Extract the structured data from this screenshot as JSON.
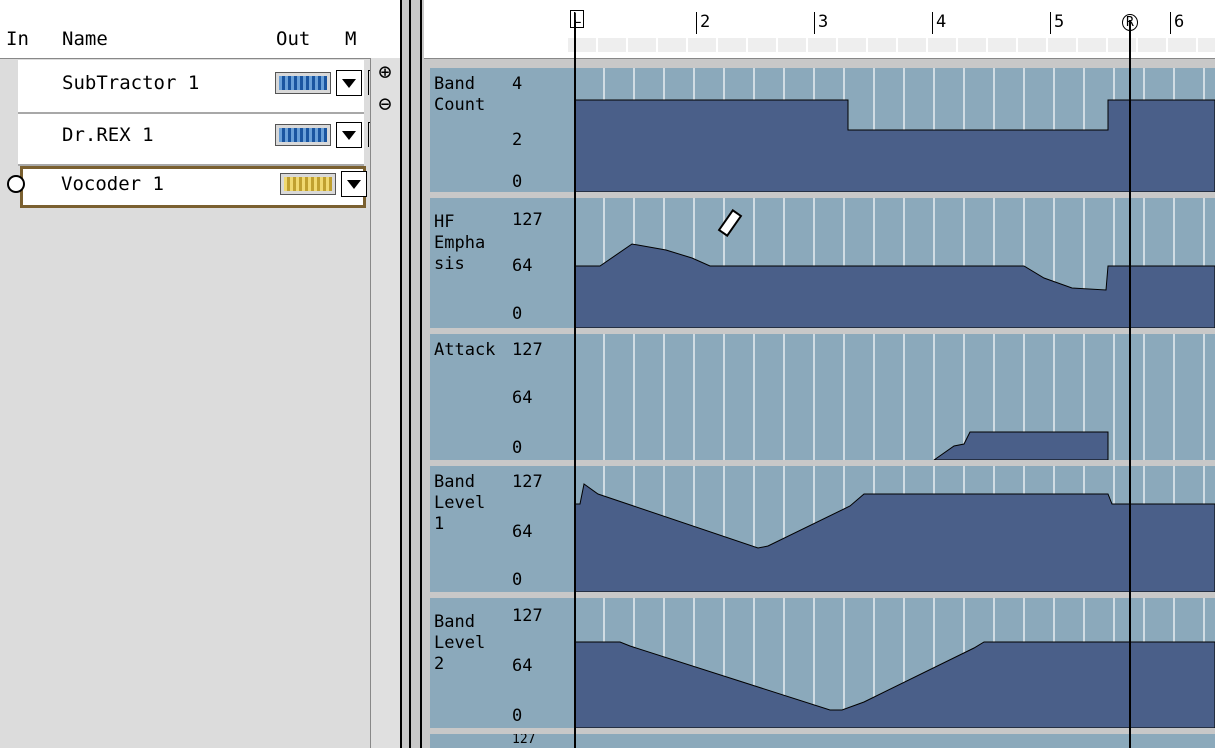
{
  "track_list": {
    "headers": {
      "in": "In",
      "name": "Name",
      "out": "Out",
      "m": "M"
    },
    "tracks": [
      {
        "name": "SubTractor 1"
      },
      {
        "name": "Dr.REX 1"
      },
      {
        "name": "Vocoder 1"
      }
    ]
  },
  "ruler": {
    "bars": [
      "2",
      "3",
      "4",
      "5",
      "6"
    ],
    "left_locator": "L",
    "right_locator": "R"
  },
  "lanes": [
    {
      "name": "Band\nCount",
      "max": "4",
      "mid": "2",
      "min": "0"
    },
    {
      "name": "HF\nEmpha\nsis",
      "max": "127",
      "mid": "64",
      "min": "0"
    },
    {
      "name": "Attack",
      "max": "127",
      "mid": "64",
      "min": "0"
    },
    {
      "name": "Band\nLevel\n1",
      "max": "127",
      "mid": "64",
      "min": "0"
    },
    {
      "name": "Band\nLevel\n2",
      "max": "127",
      "mid": "64",
      "min": "0"
    },
    {
      "name": "",
      "max": "127",
      "mid": "",
      "min": ""
    }
  ],
  "colors": {
    "lane_bg": "#8ba9bb",
    "fill": "#4a5f89",
    "selection": "#3aa0b5"
  },
  "icons": {
    "zoom_in": "zoom-in-icon",
    "zoom_out": "zoom-out-icon",
    "pencil": "pencil-icon",
    "midi": "midi-plug-icon"
  }
}
